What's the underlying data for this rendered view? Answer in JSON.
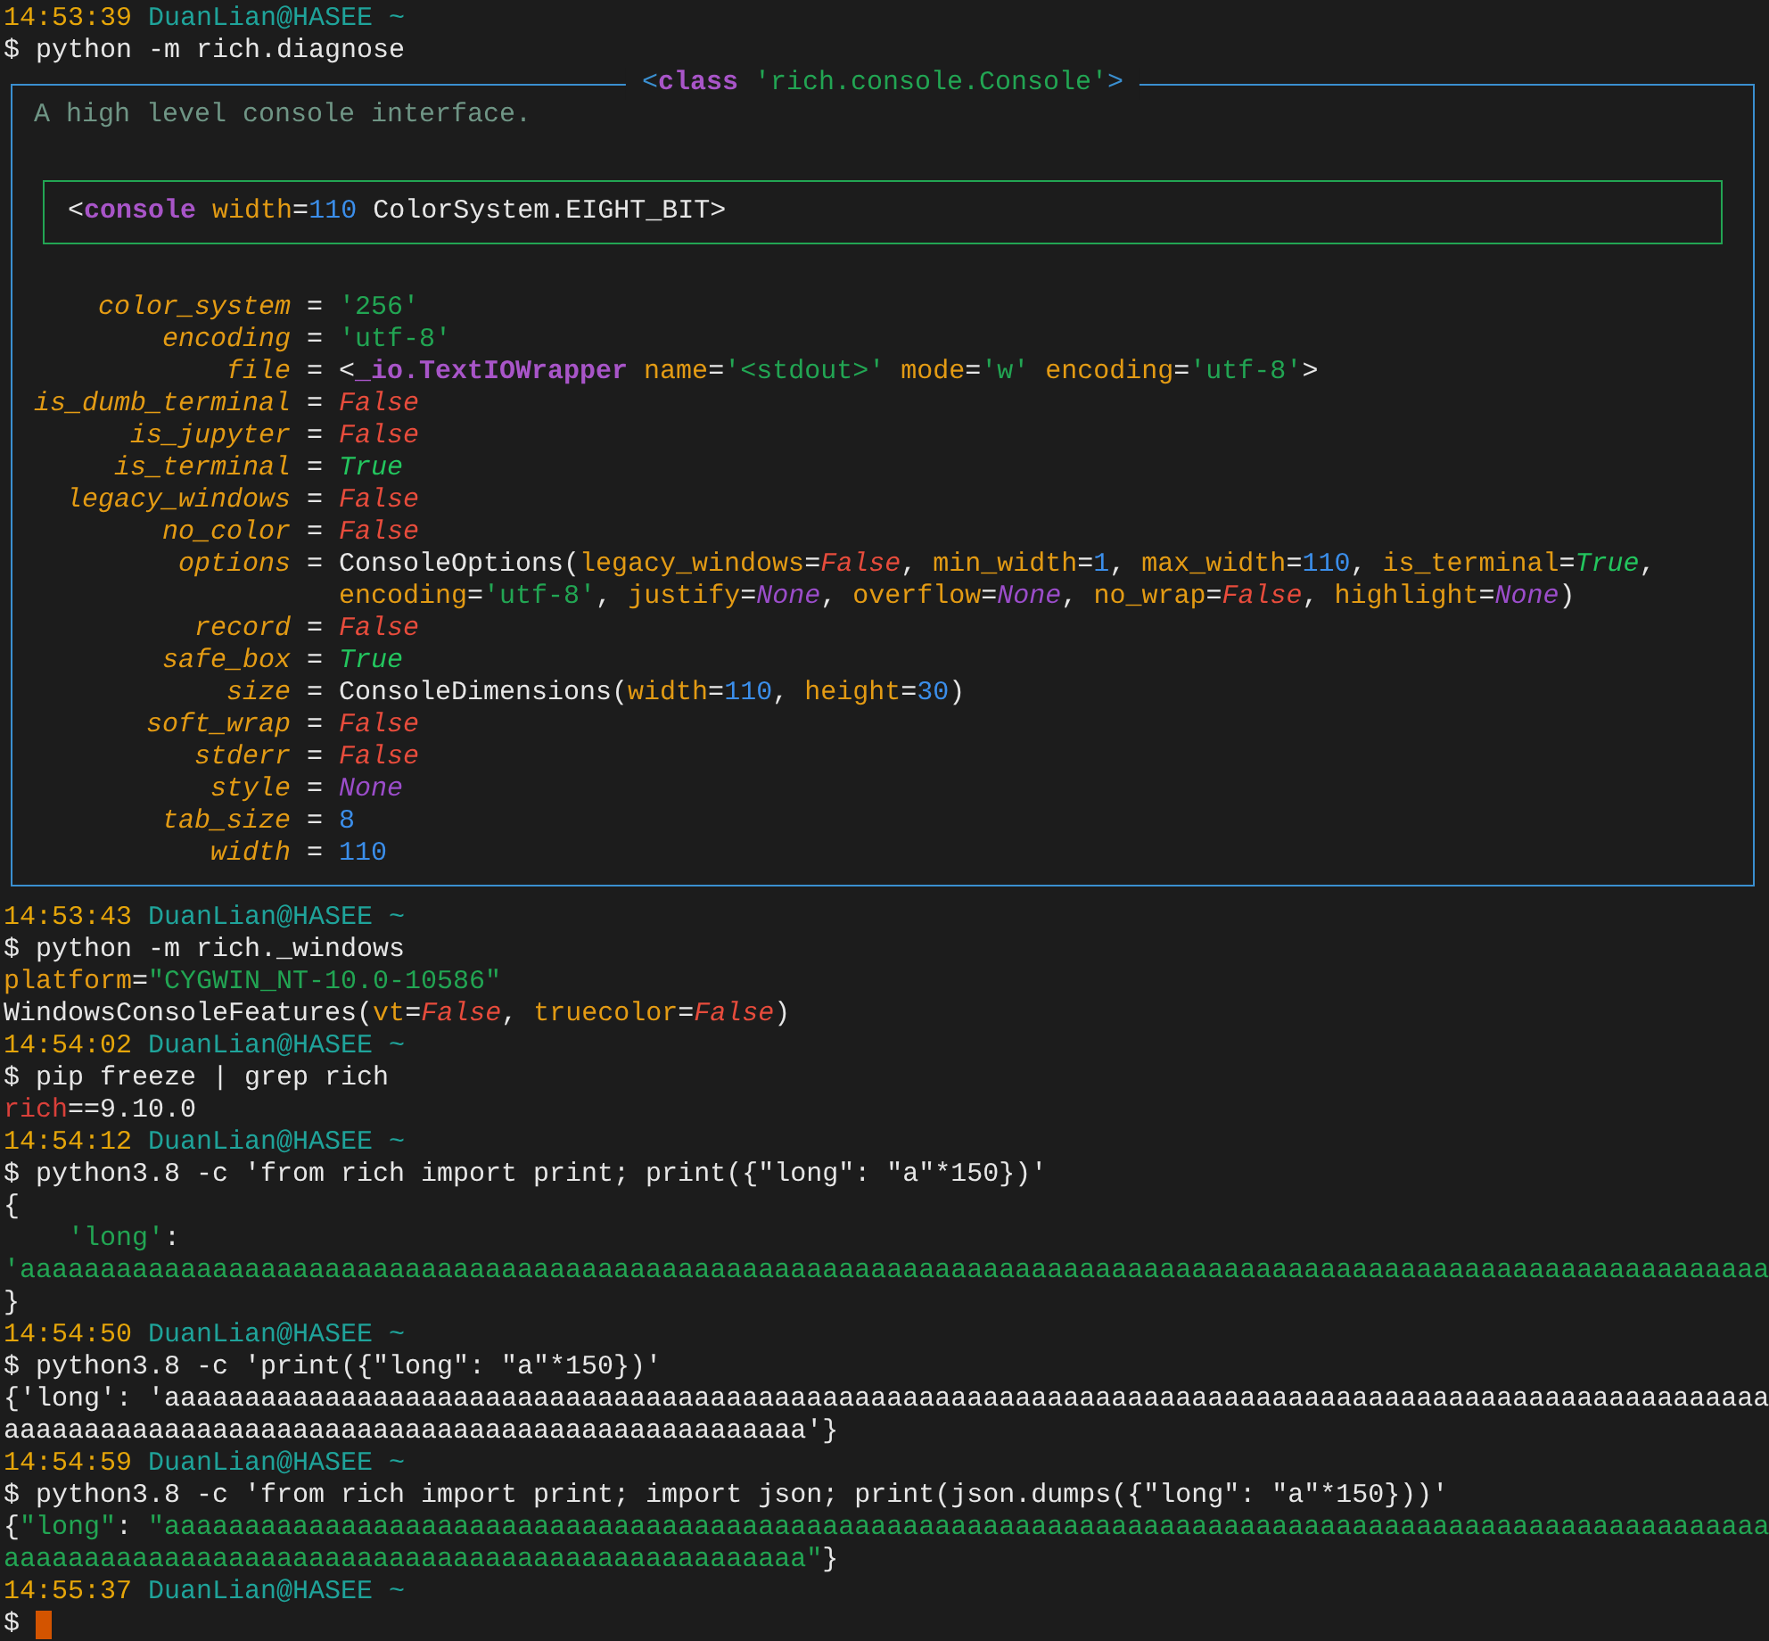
{
  "terminal": {
    "blocks": [
      {
        "kind": "line",
        "segments": [
          {
            "text": "14:53:39",
            "kind": "time"
          },
          {
            "text": " DuanLian@HASEE ~",
            "kind": "host"
          }
        ]
      },
      {
        "kind": "line",
        "segments": [
          {
            "text": "$ python -m rich.diagnose",
            "kind": "plain"
          }
        ]
      },
      {
        "kind": "panel",
        "title": [
          {
            "text": "<",
            "kind": "border"
          },
          {
            "text": "class",
            "kind": "tag"
          },
          {
            "text": " 'rich.console.Console'",
            "kind": "str"
          },
          {
            "text": ">",
            "kind": "border"
          }
        ],
        "doc": "A high level console interface.",
        "repr": [
          {
            "text": "<",
            "kind": "plain"
          },
          {
            "text": "console",
            "kind": "tag"
          },
          {
            "text": " width",
            "kind": "attr"
          },
          {
            "text": "=",
            "kind": "plain"
          },
          {
            "text": "110",
            "kind": "num"
          },
          {
            "text": " ColorSystem.EIGHT_BIT>",
            "kind": "plain"
          }
        ],
        "attributes": [
          {
            "name": "color_system",
            "separator": "=",
            "value": [
              [
                {
                  "text": "'256'",
                  "kind": "str"
                }
              ]
            ]
          },
          {
            "name": "encoding",
            "separator": "=",
            "value": [
              [
                {
                  "text": "'utf-8'",
                  "kind": "str"
                }
              ]
            ]
          },
          {
            "name": "file",
            "separator": "=",
            "value": [
              [
                {
                  "text": "<",
                  "kind": "plain"
                },
                {
                  "text": "_io.TextIOWrapper",
                  "kind": "tag"
                },
                {
                  "text": " name",
                  "kind": "attr"
                },
                {
                  "text": "=",
                  "kind": "plain"
                },
                {
                  "text": "'<stdout>'",
                  "kind": "str"
                },
                {
                  "text": " mode",
                  "kind": "attr"
                },
                {
                  "text": "=",
                  "kind": "plain"
                },
                {
                  "text": "'w'",
                  "kind": "str"
                },
                {
                  "text": " encoding",
                  "kind": "attr"
                },
                {
                  "text": "=",
                  "kind": "plain"
                },
                {
                  "text": "'utf-8'",
                  "kind": "str"
                },
                {
                  "text": ">",
                  "kind": "plain"
                }
              ]
            ]
          },
          {
            "name": "is_dumb_terminal",
            "separator": "=",
            "value": [
              [
                {
                  "text": "False",
                  "kind": "false"
                }
              ]
            ]
          },
          {
            "name": "is_jupyter",
            "separator": "=",
            "value": [
              [
                {
                  "text": "False",
                  "kind": "false"
                }
              ]
            ]
          },
          {
            "name": "is_terminal",
            "separator": "=",
            "value": [
              [
                {
                  "text": "True",
                  "kind": "true"
                }
              ]
            ]
          },
          {
            "name": "legacy_windows",
            "separator": "=",
            "value": [
              [
                {
                  "text": "False",
                  "kind": "false"
                }
              ]
            ]
          },
          {
            "name": "no_color",
            "separator": "=",
            "value": [
              [
                {
                  "text": "False",
                  "kind": "false"
                }
              ]
            ]
          },
          {
            "name": "options",
            "separator": "=",
            "value": [
              [
                {
                  "text": "ConsoleOptions(",
                  "kind": "plain"
                },
                {
                  "text": "legacy_windows",
                  "kind": "attr"
                },
                {
                  "text": "=",
                  "kind": "plain"
                },
                {
                  "text": "False",
                  "kind": "false"
                },
                {
                  "text": ", ",
                  "kind": "plain"
                },
                {
                  "text": "min_width",
                  "kind": "attr"
                },
                {
                  "text": "=",
                  "kind": "plain"
                },
                {
                  "text": "1",
                  "kind": "num"
                },
                {
                  "text": ", ",
                  "kind": "plain"
                },
                {
                  "text": "max_width",
                  "kind": "attr"
                },
                {
                  "text": "=",
                  "kind": "plain"
                },
                {
                  "text": "110",
                  "kind": "num"
                },
                {
                  "text": ", ",
                  "kind": "plain"
                },
                {
                  "text": "is_terminal",
                  "kind": "attr"
                },
                {
                  "text": "=",
                  "kind": "plain"
                },
                {
                  "text": "True",
                  "kind": "true"
                },
                {
                  "text": ",",
                  "kind": "plain"
                }
              ],
              [
                {
                  "text": "encoding",
                  "kind": "attr"
                },
                {
                  "text": "=",
                  "kind": "plain"
                },
                {
                  "text": "'utf-8'",
                  "kind": "str"
                },
                {
                  "text": ", ",
                  "kind": "plain"
                },
                {
                  "text": "justify",
                  "kind": "attr"
                },
                {
                  "text": "=",
                  "kind": "plain"
                },
                {
                  "text": "None",
                  "kind": "none"
                },
                {
                  "text": ", ",
                  "kind": "plain"
                },
                {
                  "text": "overflow",
                  "kind": "attr"
                },
                {
                  "text": "=",
                  "kind": "plain"
                },
                {
                  "text": "None",
                  "kind": "none"
                },
                {
                  "text": ", ",
                  "kind": "plain"
                },
                {
                  "text": "no_wrap",
                  "kind": "attr"
                },
                {
                  "text": "=",
                  "kind": "plain"
                },
                {
                  "text": "False",
                  "kind": "false"
                },
                {
                  "text": ", ",
                  "kind": "plain"
                },
                {
                  "text": "highlight",
                  "kind": "attr"
                },
                {
                  "text": "=",
                  "kind": "plain"
                },
                {
                  "text": "None",
                  "kind": "none"
                },
                {
                  "text": ")",
                  "kind": "plain"
                }
              ]
            ]
          },
          {
            "name": "record",
            "separator": "=",
            "value": [
              [
                {
                  "text": "False",
                  "kind": "false"
                }
              ]
            ]
          },
          {
            "name": "safe_box",
            "separator": "=",
            "value": [
              [
                {
                  "text": "True",
                  "kind": "true"
                }
              ]
            ]
          },
          {
            "name": "size",
            "separator": "=",
            "value": [
              [
                {
                  "text": "ConsoleDimensions(",
                  "kind": "plain"
                },
                {
                  "text": "width",
                  "kind": "attr"
                },
                {
                  "text": "=",
                  "kind": "plain"
                },
                {
                  "text": "110",
                  "kind": "num"
                },
                {
                  "text": ", ",
                  "kind": "plain"
                },
                {
                  "text": "height",
                  "kind": "attr"
                },
                {
                  "text": "=",
                  "kind": "plain"
                },
                {
                  "text": "30",
                  "kind": "num"
                },
                {
                  "text": ")",
                  "kind": "plain"
                }
              ]
            ]
          },
          {
            "name": "soft_wrap",
            "separator": "=",
            "value": [
              [
                {
                  "text": "False",
                  "kind": "false"
                }
              ]
            ]
          },
          {
            "name": "stderr",
            "separator": "=",
            "value": [
              [
                {
                  "text": "False",
                  "kind": "false"
                }
              ]
            ]
          },
          {
            "name": "style",
            "separator": "=",
            "value": [
              [
                {
                  "text": "None",
                  "kind": "none"
                }
              ]
            ]
          },
          {
            "name": "tab_size",
            "separator": "=",
            "value": [
              [
                {
                  "text": "8",
                  "kind": "num"
                }
              ]
            ]
          },
          {
            "name": "width",
            "separator": "=",
            "value": [
              [
                {
                  "text": "110",
                  "kind": "num"
                }
              ]
            ]
          }
        ]
      },
      {
        "kind": "line",
        "segments": [
          {
            "text": "14:53:43",
            "kind": "time"
          },
          {
            "text": " DuanLian@HASEE ~",
            "kind": "host"
          }
        ]
      },
      {
        "kind": "line",
        "segments": [
          {
            "text": "$ python -m rich._windows",
            "kind": "plain"
          }
        ]
      },
      {
        "kind": "line",
        "segments": [
          {
            "text": "platform",
            "kind": "attr"
          },
          {
            "text": "=",
            "kind": "plain"
          },
          {
            "text": "\"CYGWIN_NT-10.0-10586\"",
            "kind": "str"
          }
        ]
      },
      {
        "kind": "line",
        "segments": [
          {
            "text": "WindowsConsoleFeatures(",
            "kind": "plain"
          },
          {
            "text": "vt",
            "kind": "attr"
          },
          {
            "text": "=",
            "kind": "plain"
          },
          {
            "text": "False",
            "kind": "false"
          },
          {
            "text": ", ",
            "kind": "plain"
          },
          {
            "text": "truecolor",
            "kind": "attr"
          },
          {
            "text": "=",
            "kind": "plain"
          },
          {
            "text": "False",
            "kind": "false"
          },
          {
            "text": ")",
            "kind": "plain"
          }
        ]
      },
      {
        "kind": "line",
        "segments": [
          {
            "text": "14:54:02",
            "kind": "time"
          },
          {
            "text": " DuanLian@HASEE ~",
            "kind": "host"
          }
        ]
      },
      {
        "kind": "line",
        "segments": [
          {
            "text": "$ pip freeze | grep rich",
            "kind": "plain"
          }
        ]
      },
      {
        "kind": "line",
        "segments": [
          {
            "text": "rich",
            "kind": "red"
          },
          {
            "text": "==9.10.0",
            "kind": "plain"
          }
        ]
      },
      {
        "kind": "line",
        "segments": [
          {
            "text": "14:54:12",
            "kind": "time"
          },
          {
            "text": " DuanLian@HASEE ~",
            "kind": "host"
          }
        ]
      },
      {
        "kind": "line",
        "segments": [
          {
            "text": "$ python3.8 -c 'from rich import print; print({\"long\": \"a\"*150})'",
            "kind": "plain"
          }
        ]
      },
      {
        "kind": "line",
        "segments": [
          {
            "text": "{",
            "kind": "plain"
          }
        ]
      },
      {
        "kind": "line",
        "segments": [
          {
            "text": "    'long'",
            "kind": "str"
          },
          {
            "text": ":",
            "kind": "plain"
          }
        ]
      },
      {
        "kind": "line",
        "segments": [
          {
            "text": "'aaaaaaaaaaaaaaaaaaaaaaaaaaaaaaaaaaaaaaaaaaaaaaaaaaaaaaaaaaaaaaaaaaaaaaaaaaaaaaaaaaaaaaaaaaaaaaaaaaaaaaaaaaaaa",
            "kind": "str"
          }
        ]
      },
      {
        "kind": "line",
        "segments": [
          {
            "text": "}",
            "kind": "plain"
          }
        ]
      },
      {
        "kind": "line",
        "segments": [
          {
            "text": "14:54:50",
            "kind": "time"
          },
          {
            "text": " DuanLian@HASEE ~",
            "kind": "host"
          }
        ]
      },
      {
        "kind": "line",
        "segments": [
          {
            "text": "$ python3.8 -c 'print({\"long\": \"a\"*150})'",
            "kind": "plain"
          }
        ]
      },
      {
        "kind": "line",
        "segments": [
          {
            "text": "{'long': 'aaaaaaaaaaaaaaaaaaaaaaaaaaaaaaaaaaaaaaaaaaaaaaaaaaaaaaaaaaaaaaaaaaaaaaaaaaaaaaaaaaaaaaaaaaaaaaaaaaaa",
            "kind": "plain"
          }
        ]
      },
      {
        "kind": "line",
        "segments": [
          {
            "text": "aaaaaaaaaaaaaaaaaaaaaaaaaaaaaaaaaaaaaaaaaaaaaaaaaa'}",
            "kind": "plain"
          }
        ]
      },
      {
        "kind": "line",
        "segments": [
          {
            "text": "14:54:59",
            "kind": "time"
          },
          {
            "text": " DuanLian@HASEE ~",
            "kind": "host"
          }
        ]
      },
      {
        "kind": "line",
        "segments": [
          {
            "text": "$ python3.8 -c 'from rich import print; import json; print(json.dumps({\"long\": \"a\"*150}))'",
            "kind": "plain"
          }
        ]
      },
      {
        "kind": "line",
        "segments": [
          {
            "text": "{",
            "kind": "plain"
          },
          {
            "text": "\"long\"",
            "kind": "str"
          },
          {
            "text": ": ",
            "kind": "plain"
          },
          {
            "text": "\"aaaaaaaaaaaaaaaaaaaaaaaaaaaaaaaaaaaaaaaaaaaaaaaaaaaaaaaaaaaaaaaaaaaaaaaaaaaaaaaaaaaaaaaaaaaaaaaaaaaa",
            "kind": "str"
          }
        ]
      },
      {
        "kind": "line",
        "segments": [
          {
            "text": "aaaaaaaaaaaaaaaaaaaaaaaaaaaaaaaaaaaaaaaaaaaaaaaaaa\"",
            "kind": "str"
          },
          {
            "text": "}",
            "kind": "plain"
          }
        ]
      },
      {
        "kind": "line",
        "segments": [
          {
            "text": "14:55:37",
            "kind": "time"
          },
          {
            "text": " DuanLian@HASEE ~",
            "kind": "host"
          }
        ]
      },
      {
        "kind": "line",
        "cursor": true,
        "segments": [
          {
            "text": "$",
            "kind": "plain"
          }
        ]
      }
    ]
  }
}
